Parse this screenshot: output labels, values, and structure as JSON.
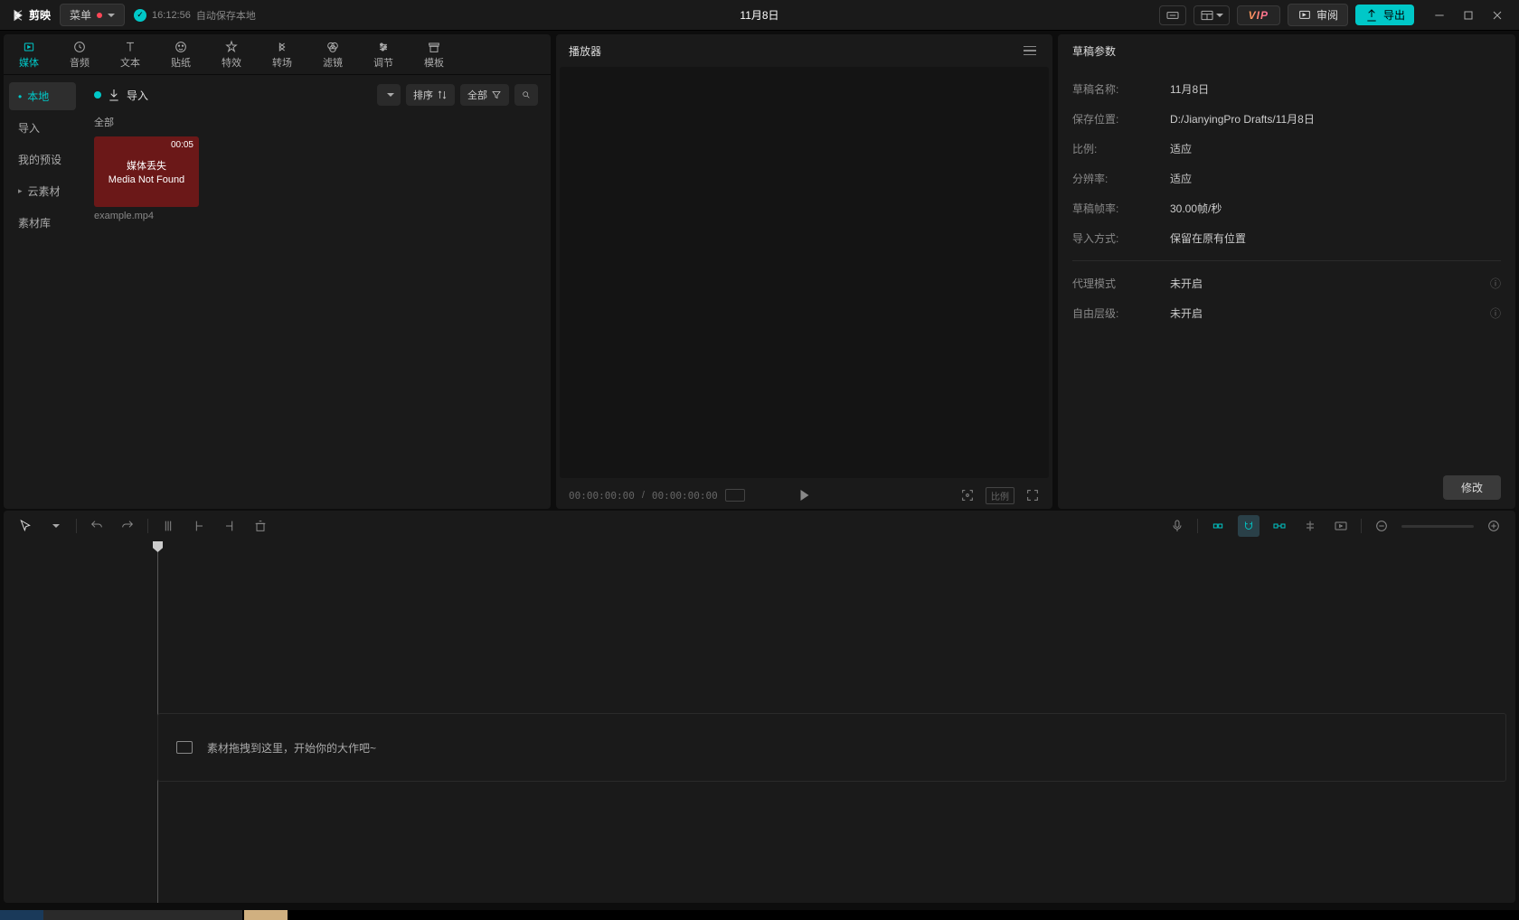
{
  "titlebar": {
    "app_name": "剪映",
    "menu_label": "菜单",
    "autosave_time": "16:12:56",
    "autosave_text": "自动保存本地",
    "document_title": "11月8日",
    "review_label": "审阅",
    "export_label": "导出",
    "vip_label": "VIP"
  },
  "main_tabs": [
    {
      "label": "媒体",
      "icon": "media"
    },
    {
      "label": "音频",
      "icon": "audio"
    },
    {
      "label": "文本",
      "icon": "text"
    },
    {
      "label": "贴纸",
      "icon": "sticker"
    },
    {
      "label": "特效",
      "icon": "effect"
    },
    {
      "label": "转场",
      "icon": "transition"
    },
    {
      "label": "滤镜",
      "icon": "filter"
    },
    {
      "label": "调节",
      "icon": "adjust"
    },
    {
      "label": "模板",
      "icon": "template"
    }
  ],
  "left_sidebar": [
    {
      "label": "本地",
      "active": true
    },
    {
      "label": "导入"
    },
    {
      "label": "我的预设"
    },
    {
      "label": "云素材",
      "expandable": true
    },
    {
      "label": "素材库"
    }
  ],
  "media_toolbar": {
    "import_label": "导入",
    "sort_label": "排序",
    "filter_label": "全部",
    "section_all": "全部"
  },
  "media_item": {
    "duration": "00:05",
    "error_line1": "媒体丢失",
    "error_line2": "Media Not Found",
    "filename": "example.mp4"
  },
  "player": {
    "header": "播放器",
    "time_current": "00:00:00:00",
    "time_total": "00:00:00:00",
    "ratio_label": "比例"
  },
  "draft_panel": {
    "header": "草稿参数",
    "rows": [
      {
        "label": "草稿名称:",
        "value": "11月8日"
      },
      {
        "label": "保存位置:",
        "value": "D:/JianyingPro Drafts/11月8日"
      },
      {
        "label": "比例:",
        "value": "适应"
      },
      {
        "label": "分辨率:",
        "value": "适应"
      },
      {
        "label": "草稿帧率:",
        "value": "30.00帧/秒"
      },
      {
        "label": "导入方式:",
        "value": "保留在原有位置"
      }
    ],
    "extra_rows": [
      {
        "label": "代理模式",
        "value": "未开启"
      },
      {
        "label": "自由层级:",
        "value": "未开启"
      }
    ],
    "modify_label": "修改"
  },
  "timeline": {
    "hint_text": "素材拖拽到这里，开始你的大作吧~"
  }
}
